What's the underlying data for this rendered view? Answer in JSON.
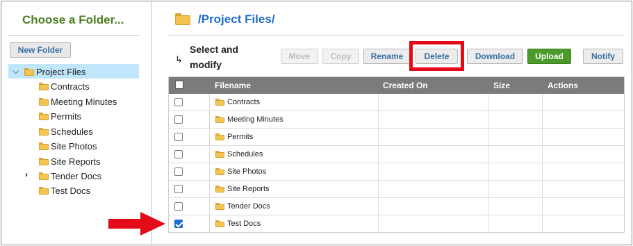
{
  "sidebar": {
    "title": "Choose a Folder...",
    "new_folder_label": "New Folder",
    "tree": [
      {
        "label": "Project Files",
        "level": 0,
        "expanded": true,
        "selected": true
      },
      {
        "label": "Contracts",
        "level": 1
      },
      {
        "label": "Meeting Minutes",
        "level": 1
      },
      {
        "label": "Permits",
        "level": 1
      },
      {
        "label": "Schedules",
        "level": 1
      },
      {
        "label": "Site Photos",
        "level": 1
      },
      {
        "label": "Site Reports",
        "level": 1
      },
      {
        "label": "Tender Docs",
        "level": 1,
        "has_children": true
      },
      {
        "label": "Test Docs",
        "level": 1
      }
    ]
  },
  "main": {
    "path": "/Project Files/",
    "select_label": "Select and modify",
    "select_arrow": "↳",
    "toolbar": {
      "move": "Move",
      "copy": "Copy",
      "rename": "Rename",
      "delete": "Delete",
      "download": "Download",
      "upload": "Upload",
      "notify": "Notify"
    },
    "columns": [
      "Filename",
      "Created On",
      "Size",
      "Actions"
    ],
    "rows": [
      {
        "name": "Contracts",
        "checked": false
      },
      {
        "name": "Meeting Minutes",
        "checked": false
      },
      {
        "name": "Permits",
        "checked": false
      },
      {
        "name": "Schedules",
        "checked": false
      },
      {
        "name": "Site Photos",
        "checked": false
      },
      {
        "name": "Site Reports",
        "checked": false
      },
      {
        "name": "Tender Docs",
        "checked": false
      },
      {
        "name": "Test Docs",
        "checked": true
      }
    ]
  },
  "colors": {
    "title_green": "#4d7e22",
    "link_blue": "#1f6fc7",
    "highlight_red": "#e30b17",
    "upload_green": "#4c9a2a",
    "selected_bg": "#bfe6fb"
  }
}
